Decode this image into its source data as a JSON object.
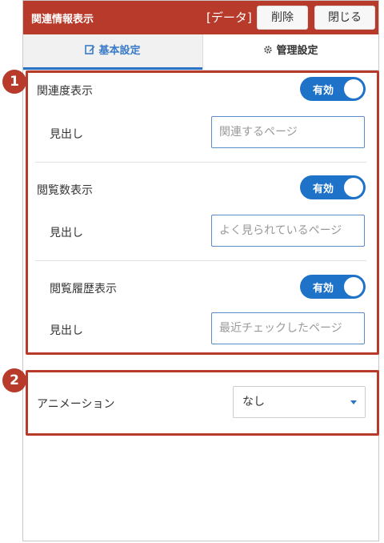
{
  "header": {
    "title": "関連情報表示",
    "data_label": "[データ]",
    "delete_label": "削除",
    "close_label": "閉じる"
  },
  "tabs": [
    {
      "label": "基本設定",
      "icon": "edit-icon",
      "active": true
    },
    {
      "label": "管理設定",
      "icon": "gear-icon",
      "active": false
    }
  ],
  "badges": [
    "1",
    "2"
  ],
  "section1": {
    "related": {
      "label": "関連度表示",
      "toggle": "有効",
      "heading_label": "見出し",
      "heading_value": "関連するページ"
    },
    "views": {
      "label": "閲覧数表示",
      "toggle": "有効",
      "heading_label": "見出し",
      "heading_value": "よく見られているページ"
    },
    "history": {
      "label": "閲覧履歴表示",
      "toggle": "有効",
      "heading_label": "見出し",
      "heading_value": "最近チェックしたページ"
    }
  },
  "section2": {
    "animation_label": "アニメーション",
    "animation_value": "なし"
  },
  "colors": {
    "header": "#b83a2b",
    "accent": "#1e72c7",
    "frame": "#b83a2b"
  }
}
